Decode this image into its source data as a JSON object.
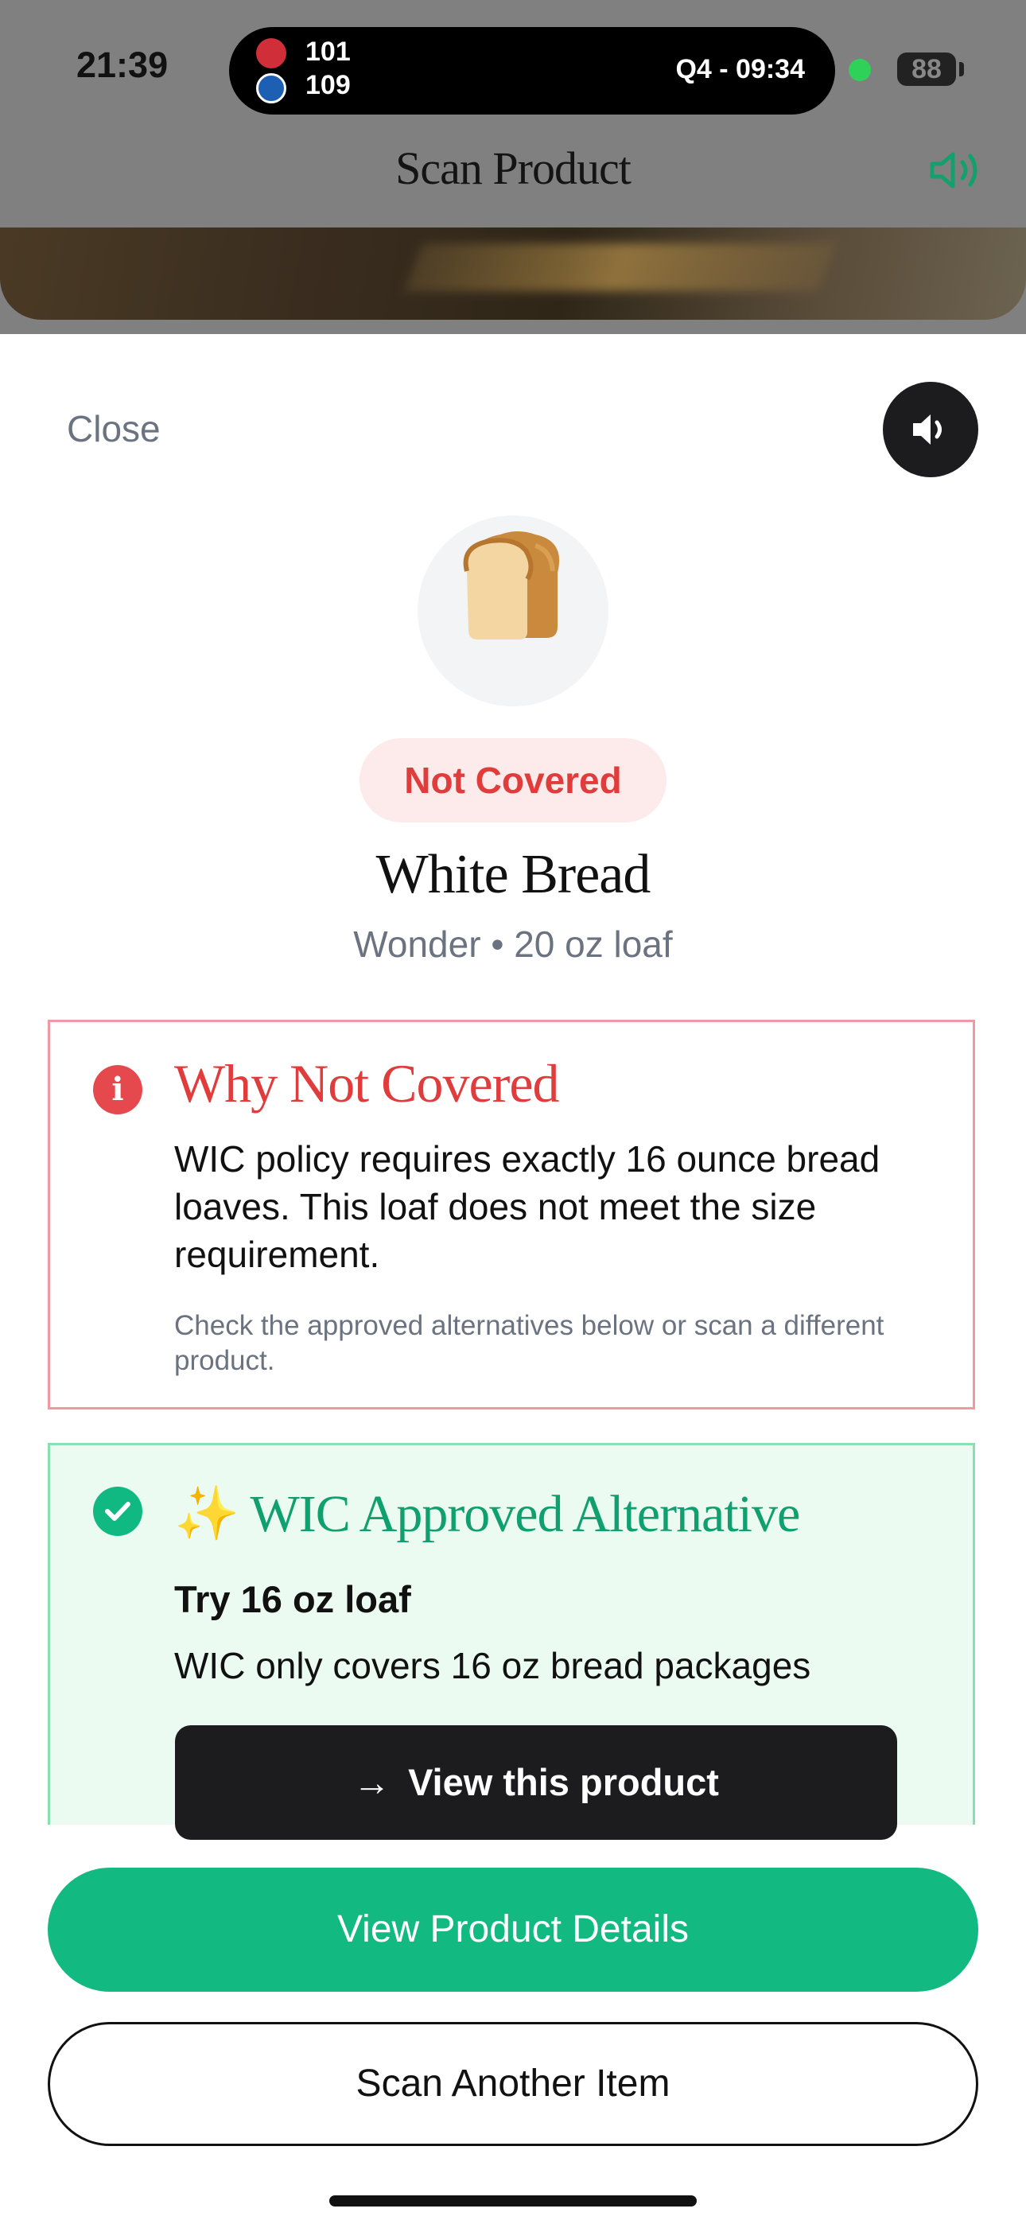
{
  "status_bar": {
    "time": "21:39",
    "live_activity": {
      "team1_score": "101",
      "team2_score": "109",
      "game_clock": "Q4 - 09:34"
    },
    "battery": "88"
  },
  "header": {
    "title": "Scan Product"
  },
  "sheet": {
    "close_label": "Close",
    "product_emoji_icon": "bread-icon",
    "status_badge": "Not Covered",
    "product_name": "White Bread",
    "product_meta": "Wonder • 20 oz loaf",
    "why_card": {
      "title": "Why Not Covered",
      "body": "WIC policy requires exactly 16 ounce bread loaves. This loaf does not meet the size requirement.",
      "note": "Check the approved alternatives below or scan a different product."
    },
    "alternative_card": {
      "sparkle": "✨",
      "title": "WIC Approved Alternative",
      "suggestion": "Try 16 oz loaf",
      "description": "WIC only covers 16 oz bread packages",
      "button_label": "View this product"
    },
    "primary_button": "View Product Details",
    "secondary_button": "Scan Another Item"
  },
  "colors": {
    "accent_green": "#12b981",
    "error_red": "#e03c3c",
    "dark": "#1c1c1e"
  }
}
